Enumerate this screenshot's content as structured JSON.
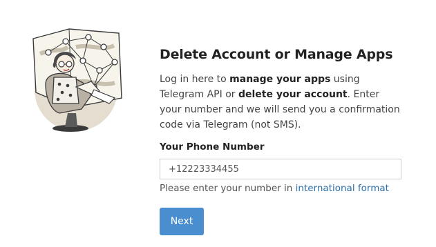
{
  "page": {
    "title": "Delete Account or Manage Apps",
    "description": {
      "part1": "Log in here to ",
      "bold1": "manage your apps",
      "part2": " using Telegram API or ",
      "bold2": "delete your account",
      "part3": ". Enter your number and we will send you a confirmation code via Telegram (not SMS)."
    }
  },
  "form": {
    "phone_label": "Your Phone Number",
    "phone_placeholder": "+12223334455",
    "phone_value": "",
    "hint_text": "Please enter your number in ",
    "hint_link": "international format",
    "next_label": "Next"
  },
  "colors": {
    "accent": "#4a8ecf",
    "link": "#2a6fab"
  },
  "icons": {
    "illustration": "telegram-dev-illustration"
  }
}
